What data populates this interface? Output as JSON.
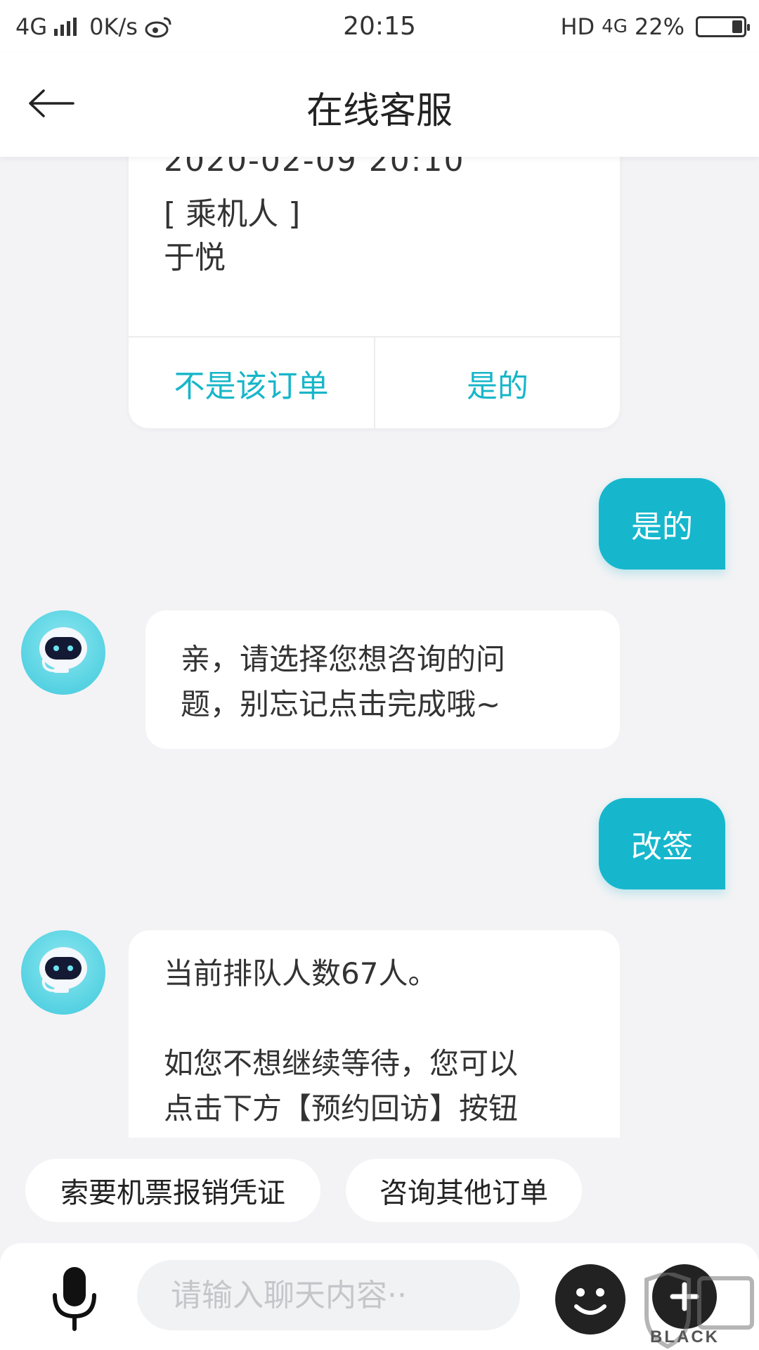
{
  "status_bar": {
    "network": "4G",
    "speed": "0K/s",
    "time": "20:15",
    "hd": "HD",
    "network_right": "4G",
    "battery": "22%"
  },
  "header": {
    "title": "在线客服"
  },
  "messages": {
    "order_card": {
      "date_line": "2020-02-09 20:10",
      "passenger_label": "[ 乘机人 ]",
      "passenger_name": "于悦",
      "option_no": "不是该订单",
      "option_yes": "是的"
    },
    "user_1": "是的",
    "bot_1_line1": "亲，请选择您想咨询的问",
    "bot_1_line2": "题，别忘记点击完成哦~",
    "user_2": "改签",
    "bot_2_line1": "当前排队人数67人。",
    "bot_2_line2": "如您不想继续等待，您可以",
    "bot_2_line3": "点击下方【预约回访】按钮"
  },
  "quick_replies": [
    "索要机票报销凭证",
    "咨询其他订单"
  ],
  "input": {
    "placeholder": "请输入聊天内容··"
  },
  "watermark": {
    "text": "BLACK CAT"
  },
  "colors": {
    "accent": "#16b7cd",
    "background": "#f3f3f5"
  }
}
